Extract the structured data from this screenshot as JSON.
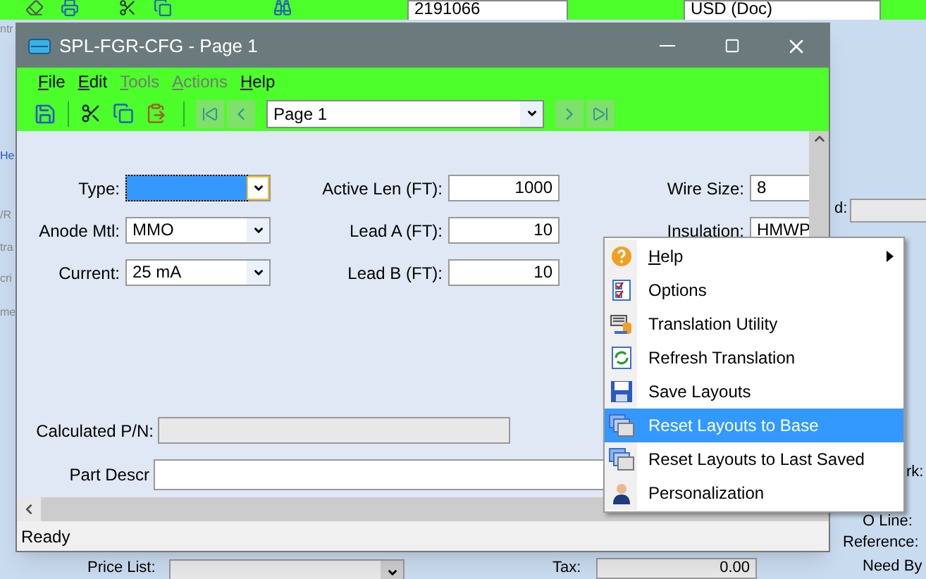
{
  "background_app": {
    "toolbar_fields": [
      "2191066",
      "USD (Doc)"
    ],
    "left_labels": [
      "ntr",
      "He",
      "/R",
      "tra",
      "cri",
      "me"
    ],
    "right_labels": [
      "d:",
      "rk:",
      "O Line:",
      "Reference:",
      "Need By"
    ],
    "price_list_label": "Price List:",
    "tax_label": "Tax:",
    "tax_value": "0.00"
  },
  "window": {
    "title": "SPL-FGR-CFG - Page 1",
    "menu": [
      {
        "label": "File",
        "disabled": false
      },
      {
        "label": "Edit",
        "disabled": false
      },
      {
        "label": "Tools",
        "disabled": true
      },
      {
        "label": "Actions",
        "disabled": true
      },
      {
        "label": "Help",
        "disabled": false
      }
    ],
    "page_selector": "Page 1",
    "columns": [
      [
        {
          "label": "Type:",
          "kind": "combo",
          "focused": true
        },
        {
          "label": "Anode Mtl:",
          "kind": "combo",
          "value": "MMO",
          "focused": false
        },
        {
          "label": "Current:",
          "kind": "combo",
          "value": "25 mA",
          "focused": false
        }
      ],
      [
        {
          "label": "Active Len (FT):",
          "kind": "number",
          "value": "1000"
        },
        {
          "label": "Lead A (FT):",
          "kind": "number",
          "value": "10"
        },
        {
          "label": "Lead B (FT):",
          "kind": "number",
          "value": "10"
        }
      ],
      [
        {
          "label": "Wire Size:",
          "kind": "text",
          "value": "8"
        },
        {
          "label": "Insulation:",
          "kind": "text",
          "value": "HMWP"
        }
      ]
    ],
    "calculated_pn": {
      "label": "Calculated P/N:",
      "disabled": true
    },
    "part_descr": {
      "label": "Part Descr"
    },
    "status_bar": "Ready"
  },
  "context_menu": [
    {
      "label": "Help",
      "kind": "help",
      "submenu": true,
      "selected": false
    },
    {
      "label": "Options",
      "kind": "options",
      "submenu": false,
      "selected": false
    },
    {
      "label": "Translation Utility",
      "kind": "translate",
      "submenu": false,
      "selected": false
    },
    {
      "label": "Refresh Translation",
      "kind": "refresh",
      "submenu": false,
      "selected": false
    },
    {
      "label": "Save Layouts",
      "kind": "save",
      "submenu": false,
      "selected": false
    },
    {
      "label": "Reset Layouts to Base",
      "kind": "layers",
      "submenu": false,
      "selected": true
    },
    {
      "label": "Reset Layouts to Last Saved",
      "kind": "layers",
      "submenu": false,
      "selected": false
    },
    {
      "label": "Personalization",
      "kind": "user",
      "submenu": false,
      "selected": false
    }
  ]
}
